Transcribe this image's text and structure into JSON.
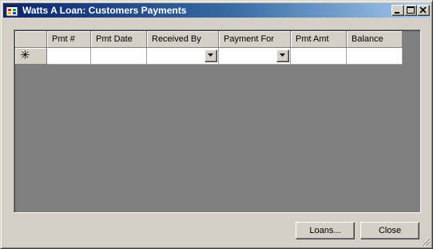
{
  "window": {
    "title": "Watts A Loan: Customers Payments",
    "title_bar_color": "#0a246a",
    "background_color": "#d4d0c8"
  },
  "title_buttons": {
    "minimize": "minimize-icon",
    "maximize": "maximize-icon",
    "close": "close-icon"
  },
  "grid": {
    "row_header_symbol": "✳",
    "columns": [
      "Pmt #",
      "Pmt Date",
      "Received By",
      "Payment For",
      "Pmt Amt",
      "Balance"
    ],
    "new_row": [
      "",
      "",
      "",
      "",
      "",
      ""
    ],
    "background_color": "#808080"
  },
  "buttons": {
    "loans_label": "Loans...",
    "close_label": "Close"
  }
}
